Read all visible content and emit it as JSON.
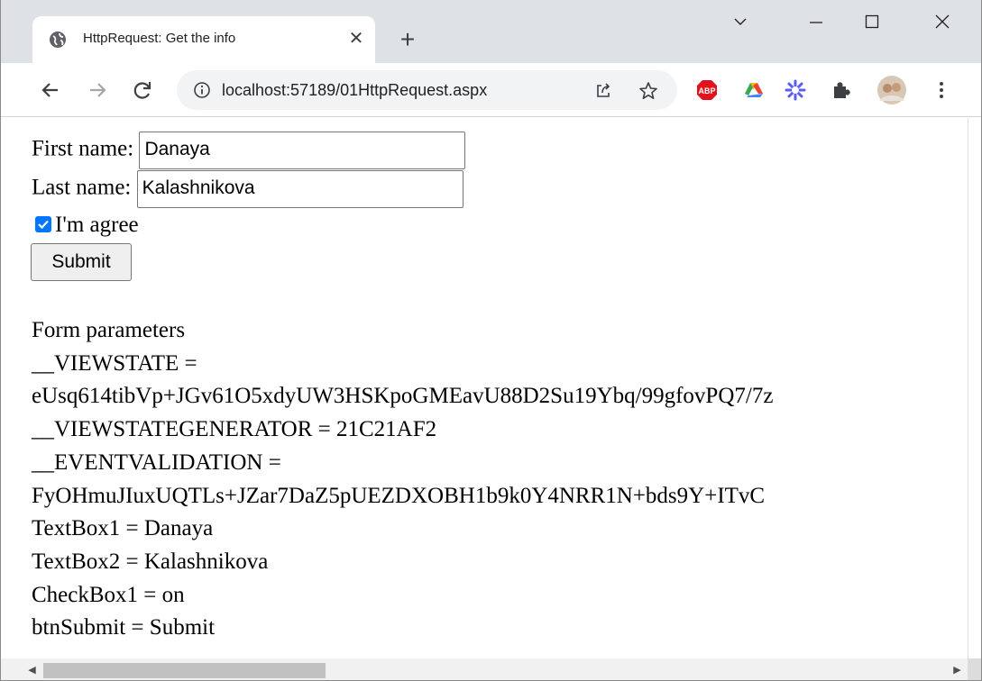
{
  "browser": {
    "tab_title": "HttpRequest: Get the info",
    "url": "localhost:57189/01HttpRequest.aspx",
    "accent_color": "#0075ff"
  },
  "form": {
    "first_name_label": "First name:",
    "first_name_value": "Danaya",
    "last_name_label": "Last name:",
    "last_name_value": "Kalashnikova",
    "agree_label": "I'm agree",
    "agree_checked": true,
    "submit_label": "Submit"
  },
  "output": {
    "heading": "Form parameters",
    "lines": [
      "__VIEWSTATE =",
      "eUsq614tibVp+JGv61O5xdyUW3HSKpoGMEavU88D2Su19Ybq/99gfovPQ7/7z",
      "__VIEWSTATEGENERATOR = 21C21AF2",
      "__EVENTVALIDATION =",
      "FyOHmuJIuxUQTLs+JZar7DaZ5pUEZDXOBH1b9k0Y4NRR1N+bds9Y+ITvC",
      "TextBox1 = Danaya",
      "TextBox2 = Kalashnikova",
      "CheckBox1 = on",
      "btnSubmit = Submit"
    ]
  },
  "icons": {
    "favicon": "globe-icon",
    "close": "close-icon",
    "new_tab": "plus-icon",
    "back": "back-arrow-icon",
    "forward": "forward-arrow-icon",
    "reload": "reload-icon",
    "info": "info-icon",
    "share": "share-icon",
    "bookmark": "star-icon",
    "extensions": [
      "abp-icon",
      "google-drive-icon",
      "asterisk-extension-icon",
      "puzzle-icon",
      "profile-avatar"
    ],
    "menu": "kebab-menu-icon"
  }
}
